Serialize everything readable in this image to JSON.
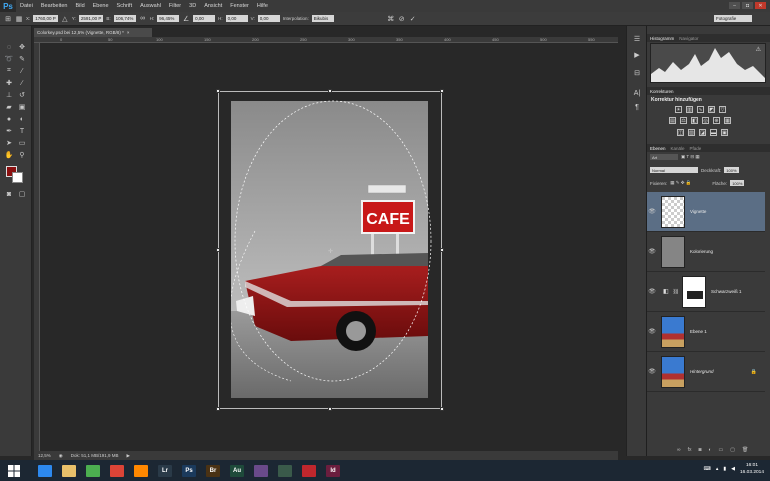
{
  "app": {
    "logo": "Ps"
  },
  "menu": [
    "Datei",
    "Bearbeiten",
    "Bild",
    "Ebene",
    "Schrift",
    "Auswahl",
    "Filter",
    "3D",
    "Ansicht",
    "Fenster",
    "Hilfe"
  ],
  "window_controls": {
    "minimize": "–",
    "restore": "◘",
    "close": "✕"
  },
  "options": {
    "x": "1760,00 P",
    "y": "2591,00 P",
    "w_label": "B:",
    "w": "106,74%",
    "h_label": "H:",
    "h": "96,45%",
    "angle": "0,00",
    "hskew_label": "H:",
    "hskew": "0,00",
    "vskew_label": "V:",
    "vskew": "0,00",
    "interp_label": "Interpolation:",
    "interp": "Bikubis",
    "workspace": "Fotografie"
  },
  "document": {
    "tab": "Colorkey.psd bei 12,5% (Vignette, RGB/8) *",
    "close": "×",
    "ruler_marks": [
      "0",
      "50",
      "100",
      "150",
      "200",
      "250",
      "300",
      "350",
      "400",
      "450",
      "500",
      "550"
    ],
    "sign_text": "CAFE"
  },
  "status": {
    "zoom": "12,5%",
    "doc": "Dok: 51,1 MB/191,9 MB"
  },
  "panels": {
    "tabs1": [
      "Histogramm",
      "Navigator"
    ],
    "tabs2": [
      "Korrekturen"
    ],
    "korr_title": "Korrektur hinzufügen",
    "tabs3": [
      "Ebenen",
      "Kanäle",
      "Pfade"
    ],
    "kind": "Art",
    "blend": "Normal",
    "opacity_label": "Deckkraft:",
    "opacity": "100%",
    "fill_label": "Fläche:",
    "fill": "100%",
    "lock_label": "Fixieren:",
    "layers": [
      {
        "name": "Vignette",
        "selected": true,
        "type": "transparent"
      },
      {
        "name": "Kolorierung",
        "selected": false,
        "type": "gray"
      },
      {
        "name": "Schwarzweiß 1",
        "selected": false,
        "type": "mask"
      },
      {
        "name": "Ebene 1",
        "selected": false,
        "type": "photo"
      },
      {
        "name": "Hintergrund",
        "selected": false,
        "type": "photo",
        "locked": true
      }
    ]
  },
  "taskbar": {
    "apps": [
      {
        "label": "",
        "color": "#2d89ef"
      },
      {
        "label": "",
        "color": "#e8c06a"
      },
      {
        "label": "",
        "color": "#4caf50"
      },
      {
        "label": "",
        "color": "#db4437"
      },
      {
        "label": "",
        "color": "#ff8800"
      },
      {
        "label": "Lr",
        "color": "#2a3a48"
      },
      {
        "label": "Ps",
        "color": "#1b3a5c"
      },
      {
        "label": "Br",
        "color": "#4a3214"
      },
      {
        "label": "Au",
        "color": "#1e4a3a"
      },
      {
        "label": "",
        "color": "#6a4a8a"
      },
      {
        "label": "",
        "color": "#3a5a4a"
      },
      {
        "label": "",
        "color": "#c0272d"
      },
      {
        "label": "Id",
        "color": "#6b1e3e"
      }
    ],
    "time": "16:01",
    "date": "16.03.2014"
  }
}
